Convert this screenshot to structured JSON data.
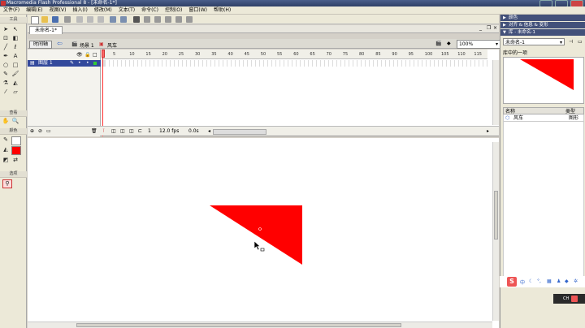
{
  "window": {
    "title": "Macromedia Flash Professional 8 - [未命名-1*]"
  },
  "menu": [
    "文件(F)",
    "编辑(E)",
    "视图(V)",
    "插入(I)",
    "修改(M)",
    "文本(T)",
    "命令(C)",
    "控制(O)",
    "窗口(W)",
    "帮助(H)"
  ],
  "tools": {
    "header": "工具",
    "view_label": "查看",
    "color_label": "颜色",
    "options_label": "选项"
  },
  "document": {
    "tab": "未命名-1*",
    "timeline_button": "时间轴",
    "scene": "场景 1",
    "symbol": "风车",
    "zoom": "100%"
  },
  "timeline": {
    "layer": "图层 1",
    "frame_numbers": [
      "5",
      "10",
      "15",
      "20",
      "25",
      "30",
      "35",
      "40",
      "45",
      "50",
      "55",
      "60",
      "65",
      "70",
      "75",
      "80",
      "85",
      "90",
      "95",
      "100",
      "105",
      "110",
      "115"
    ],
    "current_frame": "1",
    "fps": "12.0 fps",
    "time": "0.0s"
  },
  "panels": {
    "color": "颜色",
    "align": "对齐 & 信息 & 变形",
    "library": "库 - 未命名-1",
    "library_select": "未命名-1",
    "item_count": "库中的一项",
    "col_name": "名称",
    "col_type": "类型",
    "item_name": "风车",
    "item_type": "图形"
  },
  "taskbar": {
    "lang": "CH"
  },
  "colors": {
    "shape_fill": "#ff0000",
    "panel_header": "#43517a",
    "layer_selected": "#33499c"
  }
}
